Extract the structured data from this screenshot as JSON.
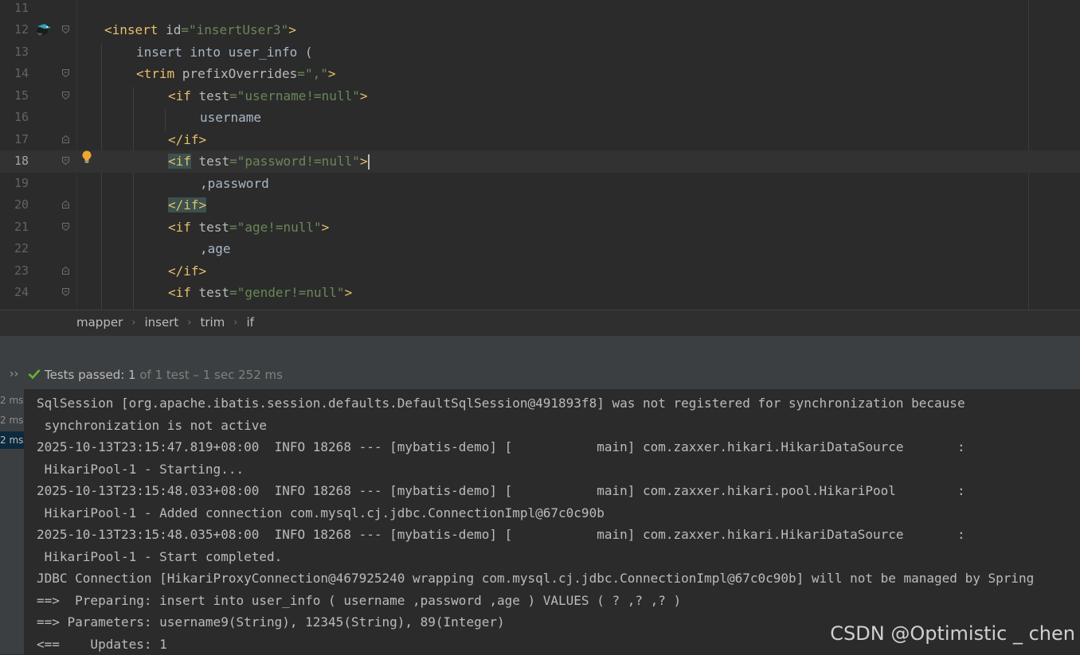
{
  "editor": {
    "lines": [
      {
        "num": "11"
      },
      {
        "num": "12",
        "t1": "<insert ",
        "a1": "id",
        "e1": "=",
        "v1": "\"insertUser3\"",
        "t2": ">"
      },
      {
        "num": "13",
        "text": "insert into user_info ("
      },
      {
        "num": "14",
        "t1": "<trim ",
        "a1": "prefixOverrides",
        "e1": "=",
        "v1": "\",\"",
        "t2": ">"
      },
      {
        "num": "15",
        "t1": "<if ",
        "a1": "test",
        "e1": "=",
        "v1": "\"username!=null\"",
        "t2": ">"
      },
      {
        "num": "16",
        "text": "username"
      },
      {
        "num": "17",
        "t1": "</if>"
      },
      {
        "num": "18",
        "t1": "<if",
        "sp": " ",
        "a1": "test",
        "e1": "=",
        "v1": "\"password!=null\"",
        "t2": ">"
      },
      {
        "num": "19",
        "text": ",password"
      },
      {
        "num": "20",
        "t1": "</if>"
      },
      {
        "num": "21",
        "t1": "<if ",
        "a1": "test",
        "e1": "=",
        "v1": "\"age!=null\"",
        "t2": ">"
      },
      {
        "num": "22",
        "text": ",age"
      },
      {
        "num": "23",
        "t1": "</if>"
      },
      {
        "num": "24",
        "t1": "<if ",
        "a1": "test",
        "e1": "=",
        "v1": "\"gender!=null\"",
        "t2": ">"
      }
    ]
  },
  "breadcrumb": {
    "items": [
      "mapper",
      "insert",
      "trim",
      "if"
    ]
  },
  "tests": {
    "chevron": "››",
    "passed": "Tests passed: ",
    "count": "1",
    "rest": " of 1 test – 1 sec 252 ms"
  },
  "timings": [
    "2 ms",
    "2 ms",
    "2 ms"
  ],
  "console": {
    "lines": [
      "SqlSession [org.apache.ibatis.session.defaults.DefaultSqlSession@491893f8] was not registered for synchronization because",
      " synchronization is not active",
      "2025-10-13T23:15:47.819+08:00  INFO 18268 --- [mybatis-demo] [           main] com.zaxxer.hikari.HikariDataSource       :",
      " HikariPool-1 - Starting...",
      "2025-10-13T23:15:48.033+08:00  INFO 18268 --- [mybatis-demo] [           main] com.zaxxer.hikari.pool.HikariPool        :",
      " HikariPool-1 - Added connection com.mysql.cj.jdbc.ConnectionImpl@67c0c90b",
      "2025-10-13T23:15:48.035+08:00  INFO 18268 --- [mybatis-demo] [           main] com.zaxxer.hikari.HikariDataSource       :",
      " HikariPool-1 - Start completed.",
      "JDBC Connection [HikariProxyConnection@467925240 wrapping com.mysql.cj.jdbc.ConnectionImpl@67c0c90b] will not be managed by Spring",
      "==>  Preparing: insert into user_info ( username ,password ,age ) VALUES ( ? ,? ,? )",
      "==> Parameters: username9(String), 12345(String), 89(Integer)",
      "<==    Updates: 1"
    ]
  },
  "watermark": "CSDN @Optimistic _ chen",
  "colors": {
    "tag": "#e8bf6a",
    "attr": "#bababa",
    "value": "#6a8759",
    "background": "#2b2b2b",
    "pass": "#5fb832"
  }
}
